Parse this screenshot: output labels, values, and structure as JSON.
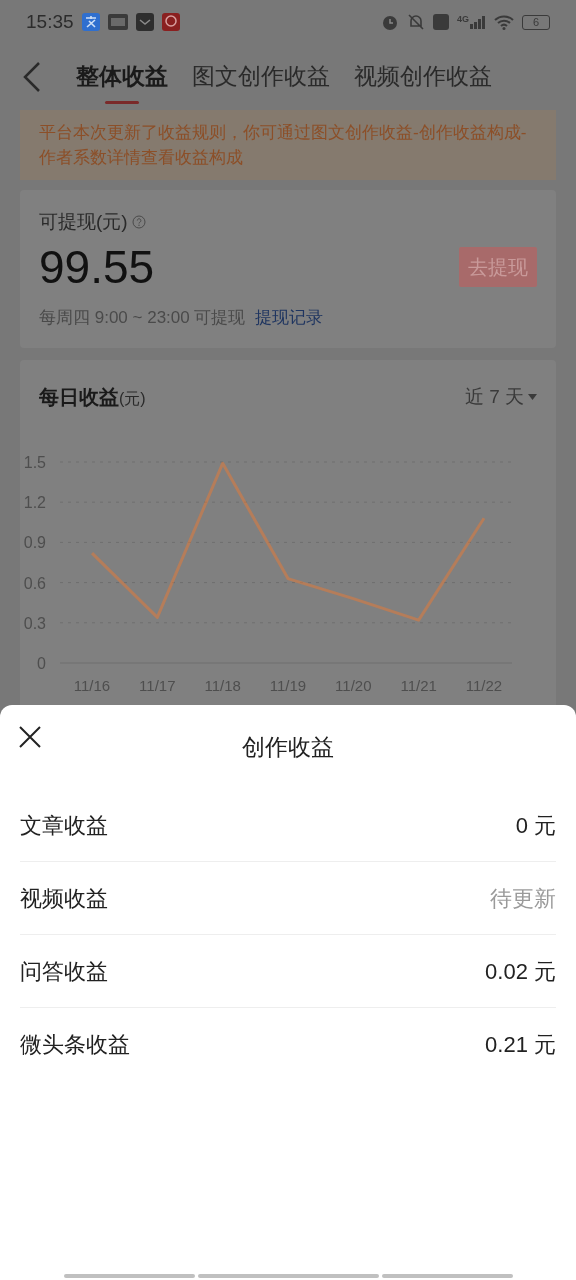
{
  "status_bar": {
    "time": "15:35",
    "battery": "6",
    "network": "4G"
  },
  "tabs": [
    {
      "label": "整体收益",
      "selected": true
    },
    {
      "label": "图文创作收益",
      "selected": false
    },
    {
      "label": "视频创作收益",
      "selected": false
    }
  ],
  "notice": "平台本次更新了收益规则，你可通过图文创作收益-创作收益构成-作者系数详情查看收益构成",
  "withdraw_card": {
    "label": "可提现(元)",
    "amount": "99.55",
    "button": "去提现",
    "schedule": "每周四 9:00 ~ 23:00 可提现",
    "link": "提现记录"
  },
  "daily_card": {
    "title": "每日收益",
    "unit": "(元)",
    "range": "近 7 天",
    "chart_data": {
      "type": "line",
      "categories": [
        "11/16",
        "11/17",
        "11/18",
        "11/19",
        "11/20",
        "11/21",
        "11/22"
      ],
      "grid": true,
      "series": [
        {
          "color": "#e07a3a",
          "values": [
            0.82,
            0.34,
            1.49,
            0.63,
            0.48,
            0.32,
            1.08
          ]
        }
      ],
      "ylim": [
        0,
        1.5
      ],
      "yticks": [
        0,
        0.3,
        0.6,
        0.9,
        1.2,
        1.5
      ]
    }
  },
  "sheet": {
    "title": "创作收益",
    "rows": [
      {
        "label": "文章收益",
        "value": "0 元",
        "pending": false
      },
      {
        "label": "视频收益",
        "value": "待更新",
        "pending": true
      },
      {
        "label": "问答收益",
        "value": "0.02 元",
        "pending": false
      },
      {
        "label": "微头条收益",
        "value": "0.21 元",
        "pending": false
      }
    ]
  }
}
